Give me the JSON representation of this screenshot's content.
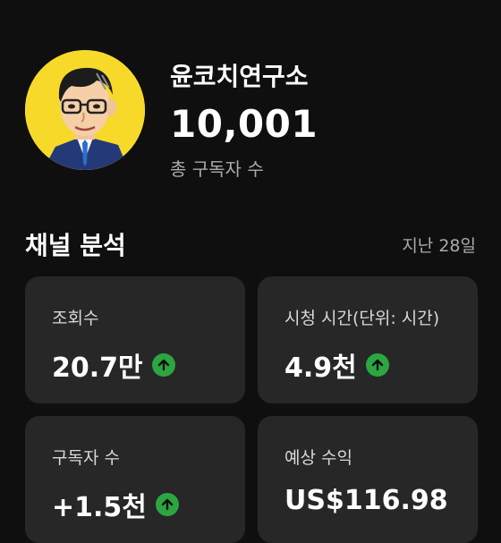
{
  "channel": {
    "name": "윤코치연구소",
    "subscriber_count": "10,001",
    "subscriber_label": "총 구독자 수"
  },
  "analytics": {
    "title": "채널 분석",
    "period": "지난 28일",
    "cards": [
      {
        "label": "조회수",
        "value": "20.7만",
        "trend": "up"
      },
      {
        "label": "시청 시간(단위: 시간)",
        "value": "4.9천",
        "trend": "up"
      },
      {
        "label": "구독자 수",
        "value": "+1.5천",
        "trend": "up"
      },
      {
        "label": "예상 수익",
        "value": "US$116.98",
        "trend": "up"
      }
    ]
  },
  "colors": {
    "background": "#0f0f0f",
    "card": "#272727",
    "trend_up": "#2ba640",
    "avatar_bg": "#f7d92a"
  }
}
